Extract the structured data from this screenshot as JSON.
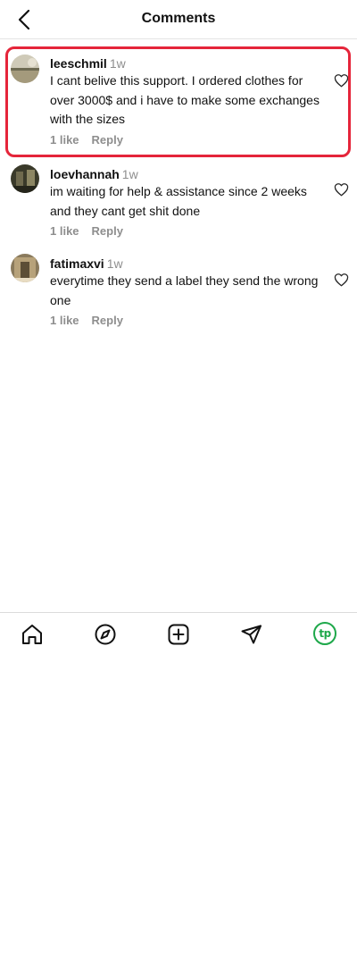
{
  "header": {
    "title": "Comments",
    "back_icon": "chevron-left-icon"
  },
  "comments": [
    {
      "username": "leeschmil",
      "time": "1w",
      "text": "I cant belive this support. I ordered clothes for over 3000$ and i have to make some exchanges with the sizes",
      "likes": "1 like",
      "reply": "Reply",
      "highlighted": true
    },
    {
      "username": "loevhannah",
      "time": "1w",
      "text": "im waiting for help & assistance since 2 weeks and they cant get shit done",
      "likes": "1 like",
      "reply": "Reply",
      "highlighted": false
    },
    {
      "username": "fatimaxvi",
      "time": "1w",
      "text": "everytime they send a label they send the wrong one",
      "likes": "1 like",
      "reply": "Reply",
      "highlighted": false
    }
  ],
  "highlight_color": "#e5253a",
  "tabbar": {
    "items": [
      "home-icon",
      "explore-compass-icon",
      "create-plus-icon",
      "direct-send-icon",
      "profile-avatar"
    ],
    "profile_label": "tp",
    "profile_color": "#1ea84a"
  }
}
